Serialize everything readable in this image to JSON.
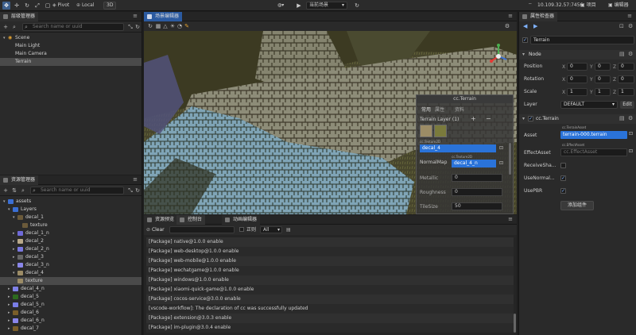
{
  "toolbar": {
    "pivot_label": "Pivot",
    "local_label": "Local",
    "dim_label": "3D",
    "scene_label": "当前场景",
    "ip": "10.109.32.57:7456",
    "project_label": "项目",
    "editor_label": "编辑器",
    "wifi_icon": "wifi-icon",
    "accent": "#2a73d9"
  },
  "hierarchy": {
    "title": "层级管理器",
    "search_placeholder": "Search name or uuid",
    "nodes": [
      {
        "label": "Scene"
      },
      {
        "label": "Main Light"
      },
      {
        "label": "Main Camera"
      },
      {
        "label": "Terrain"
      }
    ]
  },
  "assets": {
    "title": "资源管理器",
    "search_placeholder": "Search name or uuid",
    "items": [
      {
        "label": "assets",
        "color": "#3b6fd4"
      },
      {
        "label": "Layers",
        "color": "#3b6fd4"
      },
      {
        "label": "decal_1",
        "color": "#6b5a3a"
      },
      {
        "label": "texture",
        "color": "#6b5a3a"
      },
      {
        "label": "decal_1_n",
        "color": "#6f6ad8"
      },
      {
        "label": "decal_2",
        "color": "#b9a98a"
      },
      {
        "label": "decal_2_n",
        "color": "#7a78e0"
      },
      {
        "label": "decal_3",
        "color": "#666666"
      },
      {
        "label": "decal_3_n",
        "color": "#8a86e8"
      },
      {
        "label": "decal_4",
        "color": "#9c8c66"
      },
      {
        "label": "texture",
        "color": "#9c8c66"
      },
      {
        "label": "decal_4_n",
        "color": "#7f80e6"
      },
      {
        "label": "decal_5",
        "color": "#2d6a1f"
      },
      {
        "label": "decal_5_n",
        "color": "#7a7ee8"
      },
      {
        "label": "decal_6",
        "color": "#7a5e2a"
      },
      {
        "label": "decal_6_n",
        "color": "#8a86ea"
      },
      {
        "label": "decal_7",
        "color": "#7a5e2a"
      }
    ]
  },
  "scene": {
    "tab_label": "场景编辑器",
    "overlay": {
      "title": "cc.Terrain",
      "tabs": [
        "常用",
        "属性",
        "资料"
      ],
      "layer_label": "Terrain Layer (1)",
      "selected_layer": "decal_4",
      "normalmap_label": "NormalMap",
      "normalmap_tag": "cc.Texture2D",
      "normalmap_value": "decal_4_n",
      "metallic_label": "Metallic",
      "metallic_value": "0",
      "roughness_label": "Roughness",
      "roughness_value": "0",
      "tilesize_label": "TileSize",
      "tilesize_value": "50",
      "layer_tag": "cc.Texture2D"
    }
  },
  "console": {
    "tabs": [
      "资源预览",
      "控制台",
      "动画编辑器"
    ],
    "clear_label": "Clear",
    "regex_label": "正则",
    "filter_value": "All",
    "logs": [
      "[Package] native@1.0.0 enable",
      "[Package] web-desktop@1.0.0 enable",
      "[Package] web-mobile@1.0.0 enable",
      "[Package] wechatgame@1.0.0 enable",
      "[Package] windows@1.0.0 enable",
      "[Package] xiaomi-quick-game@1.0.0 enable",
      "[Package] cocos-service@3.0.0 enable",
      "[vscode-workflow]: The declaration of cc was successfully updated",
      "[Package] extension@3.0.3 enable",
      "[Package] im-plugin@3.0.4 enable"
    ]
  },
  "inspector": {
    "title": "属性检查器",
    "node_name": "Terrain",
    "node_section": "Node",
    "position_label": "Position",
    "rotation_label": "Rotation",
    "scale_label": "Scale",
    "layer_label": "Layer",
    "position": [
      "0",
      "0",
      "0"
    ],
    "rotation": [
      "0",
      "0",
      "0"
    ],
    "scale": [
      "1",
      "1",
      "1"
    ],
    "layer_value": "DEFAULT",
    "edit_label": "Edit",
    "component_label": "cc.Terrain",
    "asset_label": "Asset",
    "asset_tag": "cc.TerrainAsset",
    "asset_value": "terrain-000.terrain",
    "effect_label": "EffectAsset",
    "effect_tag": "cc.EffectAsset",
    "effect_value": "cc.EffectAsset",
    "receive_shadow_label": "ReceiveSha...",
    "use_normal_label": "UseNormal...",
    "use_pbr_label": "UsePBR",
    "add_component_label": "添加组件",
    "axes": [
      "X",
      "Y",
      "Z"
    ]
  }
}
